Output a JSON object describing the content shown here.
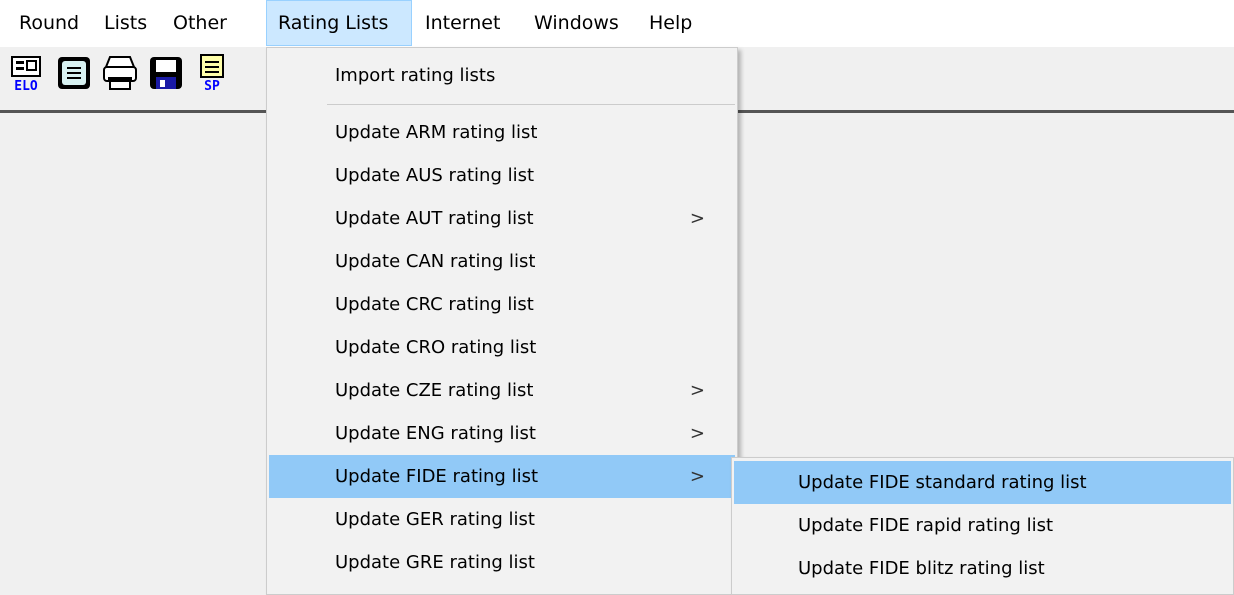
{
  "menubar": {
    "items": [
      {
        "label": "Round"
      },
      {
        "label": "Lists"
      },
      {
        "label": "Other"
      },
      {
        "label": "Rating Lists"
      },
      {
        "label": "Internet"
      },
      {
        "label": "Windows"
      },
      {
        "label": "Help"
      }
    ]
  },
  "toolbar": {
    "buttons": [
      {
        "icon": "elo-icon",
        "caption": "ELO"
      },
      {
        "icon": "monitor-icon"
      },
      {
        "icon": "printer-icon"
      },
      {
        "icon": "save-disk-icon"
      },
      {
        "icon": "sp-document-icon",
        "caption": "SP"
      }
    ]
  },
  "rating_menu": {
    "items": [
      {
        "label": "Import rating lists",
        "submenu": false
      },
      {
        "label": "Update ARM rating list",
        "submenu": false
      },
      {
        "label": "Update AUS rating list",
        "submenu": false
      },
      {
        "label": "Update AUT rating list",
        "submenu": true
      },
      {
        "label": "Update CAN rating list",
        "submenu": false
      },
      {
        "label": "Update CRC rating list",
        "submenu": false
      },
      {
        "label": "Update CRO rating list",
        "submenu": false
      },
      {
        "label": "Update CZE rating list",
        "submenu": true
      },
      {
        "label": "Update ENG rating list",
        "submenu": true
      },
      {
        "label": "Update FIDE rating list",
        "submenu": true
      },
      {
        "label": "Update GER rating list",
        "submenu": false
      },
      {
        "label": "Update GRE rating list",
        "submenu": false
      }
    ],
    "arrow_glyph": ">"
  },
  "fide_submenu": {
    "items": [
      {
        "label": "Update FIDE standard rating list"
      },
      {
        "label": "Update FIDE rapid rating list"
      },
      {
        "label": "Update FIDE blitz rating list"
      }
    ]
  },
  "colors": {
    "highlight": "#91c9f7",
    "menubar_open": "#cce8ff",
    "menu_bg": "#f2f2f2",
    "client_bg": "#f0f0f0"
  }
}
